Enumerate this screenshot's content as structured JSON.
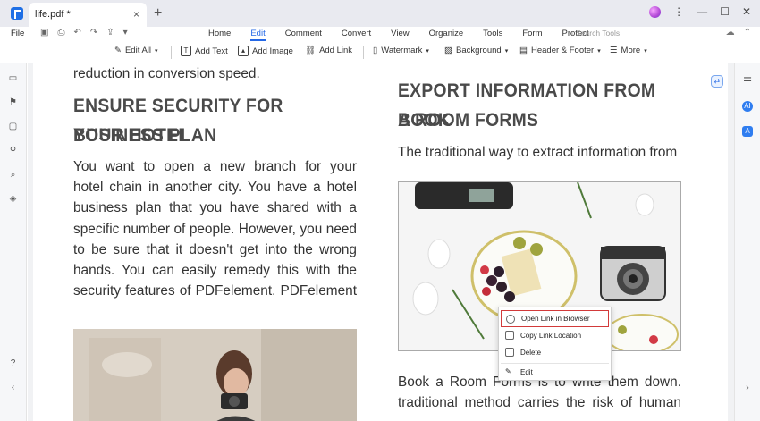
{
  "titlebar": {
    "tab_title": "life.pdf *",
    "close_glyph": "×",
    "new_tab_glyph": "+",
    "win_min": "—",
    "win_max": "☐",
    "win_close": "✕"
  },
  "menubar": {
    "file": "File",
    "items": [
      "Home",
      "Edit",
      "Comment",
      "Convert",
      "View",
      "Organize",
      "Tools",
      "Form",
      "Protect"
    ],
    "active": "Edit",
    "search_placeholder": "Search Tools"
  },
  "toolbar": {
    "edit_all": "Edit All",
    "add_text": "Add Text",
    "add_image": "Add Image",
    "add_link": "Add Link",
    "watermark": "Watermark",
    "background": "Background",
    "header_footer": "Header & Footer",
    "more": "More"
  },
  "document": {
    "top_line": "reduction in conversion speed.",
    "left_heading_1": "ENSURE SECURITY FOR YOUR HOTEL",
    "left_heading_2": "BUSINESS PLAN",
    "left_para": [
      "You want to open a new branch for your",
      "hotel chain in another city. You have a hotel",
      "business plan that you have shared with a",
      "specific number of people. However, you need",
      "to be sure that it doesn't get into the wrong",
      "hands. You can easily remedy this with the",
      "security features of PDFelement. PDFelement"
    ],
    "right_heading_1": "EXPORT INFORMATION FROM BOOK",
    "right_heading_2": "A ROOM FORMS",
    "right_intro": "The traditional way to extract information from",
    "right_bottom": [
      "Book a Room Forms is to write them down.",
      "traditional method carries the risk of human"
    ]
  },
  "context_menu": {
    "open_link": "Open Link in Browser",
    "copy_location": "Copy Link Location",
    "delete": "Delete",
    "edit": "Edit"
  },
  "right_sidebar": {
    "ai_label": "AI"
  },
  "colors": {
    "accent": "#2468e6",
    "highlight_border": "#d23a3a"
  }
}
